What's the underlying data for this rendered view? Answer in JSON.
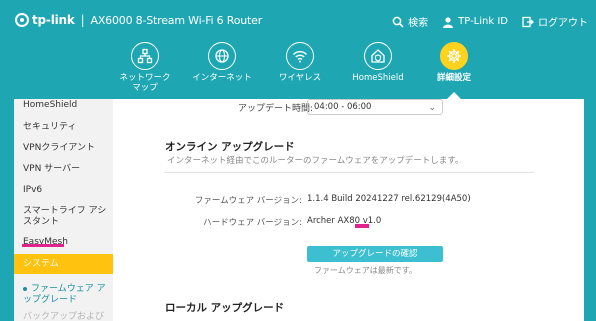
{
  "header": {
    "brand": "tp-link",
    "model": "AX6000 8-Stream Wi-Fi 6 Router",
    "actions": [
      {
        "label": "検索",
        "icon": "search-icon"
      },
      {
        "label": "TP-Link ID",
        "icon": "user-icon"
      },
      {
        "label": "ログアウト",
        "icon": "logout-icon"
      }
    ]
  },
  "nav": {
    "items": [
      {
        "label": "ネットワーク\nマップ",
        "icon": "network-map-icon"
      },
      {
        "label": "インターネット",
        "icon": "globe-icon"
      },
      {
        "label": "ワイヤレス",
        "icon": "wifi-icon"
      },
      {
        "label": "HomeShield",
        "icon": "home-shield-icon"
      },
      {
        "label": "詳細設定",
        "icon": "gear-icon",
        "active": true
      }
    ],
    "active_color": "#ffd21e"
  },
  "sidebar": {
    "items": [
      {
        "label": "HomeShield"
      },
      {
        "label": "セキュリティ"
      },
      {
        "label": "VPNクライアント"
      },
      {
        "label": "VPN サーバー"
      },
      {
        "label": "IPv6"
      },
      {
        "label": "スマートライフ アシスタント"
      },
      {
        "label": "EasyMesh"
      },
      {
        "label": "システム",
        "active": true
      },
      {
        "label": "ファームウェア アップグレード",
        "sub": true
      },
      {
        "label": "バックアップおよび",
        "faded": true
      }
    ],
    "active_color": "#ffc20e"
  },
  "main": {
    "update_time_label": "アップデート時間:",
    "update_time_value": "04:00 - 06:00",
    "online_title": "オンライン アップグレード",
    "online_desc": "インターネット経由でこのルーターのファームウェアをアップデートします。",
    "fw_label": "ファームウェア バージョン:",
    "fw_value": "1.1.4 Build 20241227 rel.62129(4A50)",
    "hw_label": "ハードウェア バージョン:",
    "hw_value": "Archer AX80 v1.0",
    "check_button": "アップグレードの確認",
    "latest_hint": "ファームウェアは最新です。",
    "local_title": "ローカル アップグレード"
  },
  "colors": {
    "header_bg": "#1ea7b3",
    "button_bg": "#3cc0d1",
    "highlight_marker": "#e0238f"
  }
}
